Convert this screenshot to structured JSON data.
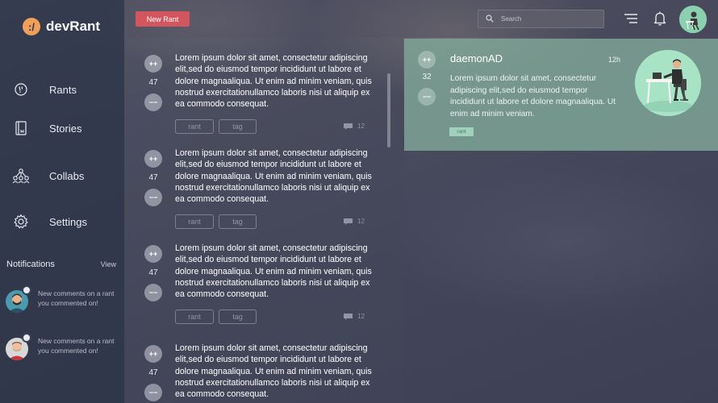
{
  "app": {
    "logo_mark": ":/",
    "name": "devRant"
  },
  "sidebar": {
    "items": [
      {
        "label": "Rants",
        "icon": "rant-bubble-icon"
      },
      {
        "label": "Stories",
        "icon": "book-icon"
      },
      {
        "label": "Collabs",
        "icon": "people-network-icon"
      },
      {
        "label": "Settings",
        "icon": "gear-icon"
      }
    ]
  },
  "notifications": {
    "title": "Notifications",
    "view_label": "View",
    "items": [
      {
        "text": "New comments on a rant you commented on!"
      },
      {
        "text": "New comments on a rant you commented on!"
      }
    ]
  },
  "topbar": {
    "new_rant_label": "New Rant",
    "search_placeholder": "Search"
  },
  "feed": {
    "posts": [
      {
        "upvote": "++",
        "score": "47",
        "downvote": "−−",
        "text": "Lorem ipsum dolor sit amet, consectetur adipiscing elit,sed do eiusmod tempor incididunt ut labore et dolore magnaaliqua. Ut enim ad minim veniam, quis nostrud exercitationullamco laboris nisi ut aliquip ex ea commodo consequat.",
        "tags": [
          "rant",
          "tag"
        ],
        "comments": "12"
      },
      {
        "upvote": "++",
        "score": "47",
        "downvote": "−−",
        "text": "Lorem ipsum dolor sit amet, consectetur adipiscing elit,sed do eiusmod tempor incididunt ut labore et dolore magnaaliqua. Ut enim ad minim veniam, quis nostrud exercitationullamco laboris nisi ut aliquip ex ea commodo consequat.",
        "tags": [
          "rant",
          "tag"
        ],
        "comments": "12"
      },
      {
        "upvote": "++",
        "score": "47",
        "downvote": "−−",
        "text": "Lorem ipsum dolor sit amet, consectetur adipiscing elit,sed do eiusmod tempor incididunt ut labore et dolore magnaaliqua. Ut enim ad minim veniam, quis nostrud exercitationullamco laboris nisi ut aliquip ex ea commodo consequat.",
        "tags": [
          "rant",
          "tag"
        ],
        "comments": "12"
      },
      {
        "upvote": "++",
        "score": "47",
        "downvote": "−−",
        "text": "Lorem ipsum dolor sit amet, consectetur adipiscing elit,sed do eiusmod tempor incididunt ut labore et dolore magnaaliqua. Ut enim ad minim veniam, quis nostrud exercitationullamco laboris nisi ut aliquip ex ea commodo consequat.",
        "tags": [],
        "comments": ""
      }
    ]
  },
  "detail": {
    "upvote": "++",
    "score": "32",
    "downvote": "−−",
    "username": "daemonAD",
    "time": "12h",
    "text": "Lorem ipsum dolor sit amet, consectetur adipiscing elit,sed do eiusmod tempor incididunt ut labore et dolore magnaaliqua. Ut enim ad minim veniam.",
    "tag": "rant"
  },
  "colors": {
    "accent_red": "#d3565f",
    "logo_orange": "#f0a05a",
    "detail_green": "#7ca094",
    "avatar_mint": "#a8e3c6"
  }
}
